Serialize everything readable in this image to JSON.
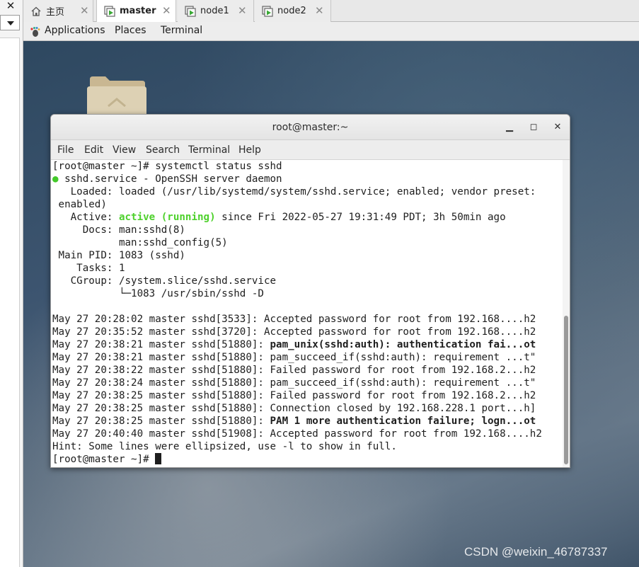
{
  "left_panel": {
    "close_glyph": "✕",
    "dropdown_icon": "chevron-down-icon"
  },
  "tabs": [
    {
      "label": "主页",
      "icon": "home-icon",
      "active": false
    },
    {
      "label": "master",
      "icon": "vm-running-icon",
      "active": true
    },
    {
      "label": "node1",
      "icon": "vm-running-icon",
      "active": false
    },
    {
      "label": "node2",
      "icon": "vm-running-icon",
      "active": false
    }
  ],
  "tab_close_glyph": "✕",
  "gnome_bar": {
    "applications": "Applications",
    "places": "Places",
    "terminal": "Terminal"
  },
  "terminal": {
    "title": "root@master:~",
    "controls": {
      "minimize": "▁",
      "maximize": "◻",
      "close": "✕"
    },
    "menu": [
      "File",
      "Edit",
      "View",
      "Search",
      "Terminal",
      "Help"
    ],
    "lines": {
      "l1": "[root@master ~]# systemctl status sshd",
      "l2_dot": "●",
      "l2": " sshd.service - OpenSSH server daemon",
      "l3": "   Loaded: loaded (/usr/lib/systemd/system/sshd.service; enabled; vendor preset:",
      "l4": " enabled)",
      "l5_pre": "   Active: ",
      "l5_status": "active (running)",
      "l5_post": " since Fri 2022-05-27 19:31:49 PDT; 3h 50min ago",
      "l6": "     Docs: man:sshd(8)",
      "l7": "           man:sshd_config(5)",
      "l8": " Main PID: 1083 (sshd)",
      "l9": "    Tasks: 1",
      "l10": "   CGroup: /system.slice/sshd.service",
      "l11": "           └─1083 /usr/sbin/sshd -D",
      "l12": "",
      "l13": "May 27 20:28:02 master sshd[3533]: Accepted password for root from 192.168....h2",
      "l14": "May 27 20:35:52 master sshd[3720]: Accepted password for root from 192.168....h2",
      "l15_pre": "May 27 20:38:21 master sshd[51880]: ",
      "l15_bold": "pam_unix(sshd:auth): authentication fai...ot",
      "l16": "May 27 20:38:21 master sshd[51880]: pam_succeed_if(sshd:auth): requirement ...t\"",
      "l17": "May 27 20:38:22 master sshd[51880]: Failed password for root from 192.168.2...h2",
      "l18": "May 27 20:38:24 master sshd[51880]: pam_succeed_if(sshd:auth): requirement ...t\"",
      "l19": "May 27 20:38:25 master sshd[51880]: Failed password for root from 192.168.2...h2",
      "l20": "May 27 20:38:25 master sshd[51880]: Connection closed by 192.168.228.1 port...h]",
      "l21_pre": "May 27 20:38:25 master sshd[51880]: ",
      "l21_bold": "PAM 1 more authentication failure; logn...ot",
      "l22": "May 27 20:40:40 master sshd[51908]: Accepted password for root from 192.168....h2",
      "l23": "Hint: Some lines were ellipsized, use -l to show in full.",
      "l24": "[root@master ~]# "
    }
  },
  "desktop": {
    "folder_icon": "home-folder-icon"
  },
  "watermark": "CSDN @weixin_46787337",
  "colors": {
    "status_green": "#4ed12c",
    "vm_icon_green": "#3aa935"
  }
}
